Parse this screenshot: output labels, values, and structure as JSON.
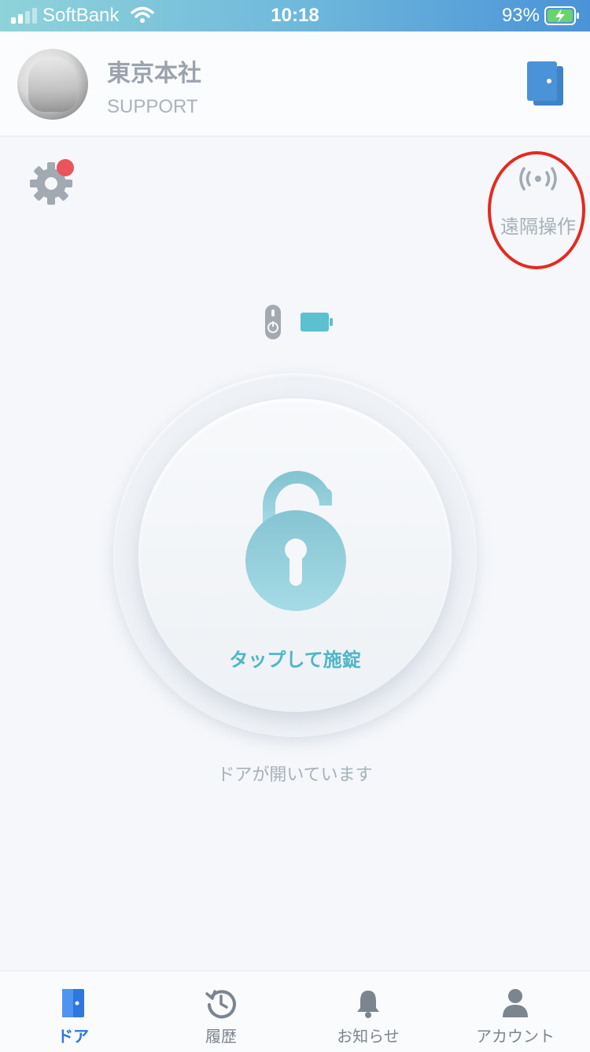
{
  "status_bar": {
    "carrier": "SoftBank",
    "time": "10:18",
    "battery_pct": "93%"
  },
  "header": {
    "org_name": "東京本社",
    "org_role": "SUPPORT"
  },
  "remote": {
    "label": "遠隔操作"
  },
  "lock": {
    "button_label": "タップして施錠",
    "door_status": "ドアが開いています"
  },
  "colors": {
    "accent": "#4fb6c6",
    "tab_active": "#2e77e0",
    "badge": "#e9555a",
    "highlight_ring": "#e32b1f"
  },
  "tabs": [
    {
      "label": "ドア",
      "icon": "door-icon",
      "active": true
    },
    {
      "label": "履歴",
      "icon": "history-icon",
      "active": false
    },
    {
      "label": "お知らせ",
      "icon": "bell-icon",
      "active": false
    },
    {
      "label": "アカウント",
      "icon": "person-icon",
      "active": false
    }
  ]
}
